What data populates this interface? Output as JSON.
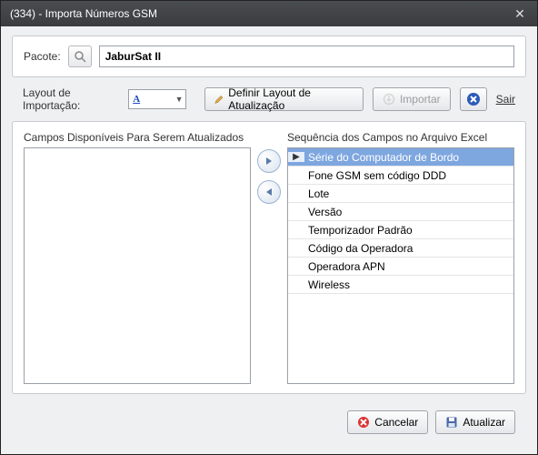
{
  "window": {
    "title": "(334) - Importa Números GSM"
  },
  "pacote": {
    "label": "Pacote:",
    "value": "JaburSat II"
  },
  "layout": {
    "label": "Layout de Importação:",
    "combo_value": "A",
    "define_btn": "Definir Layout de Atualização",
    "import_btn": "Importar",
    "exit_btn": "Sair"
  },
  "lists": {
    "left_header": "Campos Disponíveis Para Serem Atualizados",
    "right_header": "Sequência dos Campos no Arquivo Excel",
    "right_items": [
      "Série do Computador de Bordo",
      "Fone GSM sem código DDD",
      "Lote",
      "Versão",
      "Temporizador Padrão",
      "Código da Operadora",
      "Operadora APN",
      "Wireless"
    ],
    "selected_index": 0
  },
  "footer": {
    "cancel": "Cancelar",
    "update": "Atualizar"
  }
}
